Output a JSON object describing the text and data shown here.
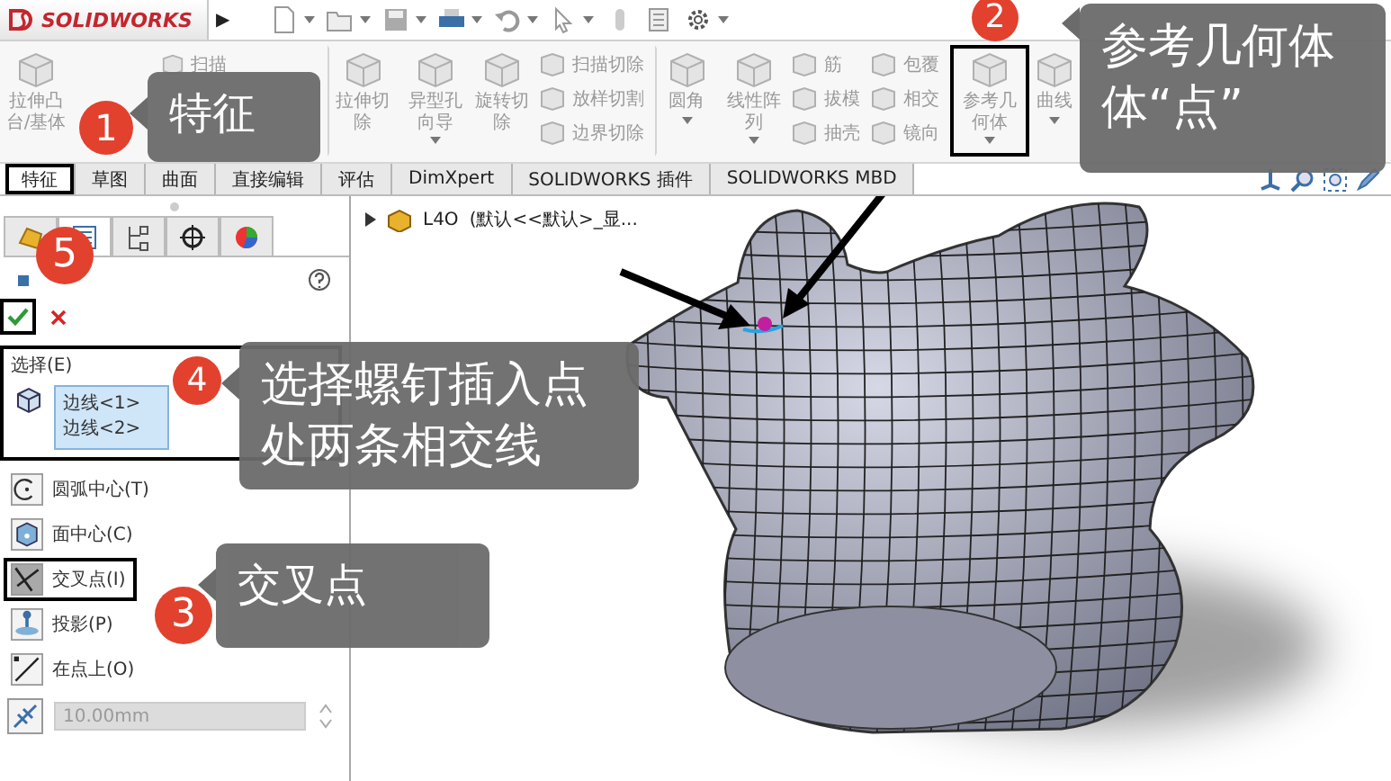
{
  "toolbar": {
    "logo": "SOLIDWORKS",
    "menu_arrow": "▶"
  },
  "ribbon": [
    {
      "kind": "large",
      "label": "拉伸凸台/基体",
      "highlighted": false,
      "dropdown": false
    },
    {
      "kind": "stack",
      "entries": [
        "扫描"
      ],
      "highlighted": false,
      "dropdown": false
    },
    {
      "kind": "large",
      "label": "拉伸切除",
      "highlighted": false,
      "dropdown": false
    },
    {
      "kind": "large",
      "label": "异型孔向导",
      "highlighted": false,
      "dropdown": true
    },
    {
      "kind": "large",
      "label": "旋转切除",
      "highlighted": false,
      "dropdown": false
    },
    {
      "kind": "stack",
      "entries": [
        "扫描切除",
        "放样切割",
        "边界切除"
      ],
      "highlighted": false,
      "dropdown": false
    },
    {
      "kind": "large",
      "label": "圆角",
      "highlighted": false,
      "dropdown": true
    },
    {
      "kind": "large",
      "label": "线性阵列",
      "highlighted": false,
      "dropdown": true
    },
    {
      "kind": "stack",
      "entries": [
        "筋",
        "拔模",
        "抽壳"
      ],
      "highlighted": false,
      "dropdown": false
    },
    {
      "kind": "stack",
      "entries": [
        "包覆",
        "相交",
        "镜向"
      ],
      "highlighted": false,
      "dropdown": false
    },
    {
      "kind": "large",
      "label": "参考几何体",
      "highlighted": true,
      "dropdown": true
    },
    {
      "kind": "large",
      "label": "曲线",
      "highlighted": false,
      "dropdown": true
    }
  ],
  "tabs": [
    {
      "label": "特征",
      "selected": true,
      "highlighted": true
    },
    {
      "label": "草图",
      "selected": false,
      "highlighted": false
    },
    {
      "label": "曲面",
      "selected": false,
      "highlighted": false
    },
    {
      "label": "直接编辑",
      "selected": false,
      "highlighted": false
    },
    {
      "label": "评估",
      "selected": false,
      "highlighted": false
    },
    {
      "label": "DimXpert",
      "selected": false,
      "highlighted": false
    },
    {
      "label": "SOLIDWORKS 插件",
      "selected": false,
      "highlighted": false
    },
    {
      "label": "SOLIDWORKS MBD",
      "selected": false,
      "highlighted": false
    }
  ],
  "panel": {
    "tabs": [
      {
        "kind": "feature",
        "selected": false
      },
      {
        "kind": "property",
        "selected": true
      },
      {
        "kind": "config",
        "selected": false
      },
      {
        "kind": "crosshair",
        "selected": false
      },
      {
        "kind": "appearance",
        "selected": false
      }
    ],
    "ok": {
      "highlighted": true
    },
    "selection": {
      "title": "选择(E)",
      "highlighted": true,
      "entries": [
        "边线<1>",
        "边线<2>"
      ]
    },
    "options": [
      {
        "kind": "arc-center",
        "label": "圆弧中心(T)",
        "selected": false,
        "highlighted": false
      },
      {
        "kind": "face-center",
        "label": "面中心(C)",
        "selected": false,
        "highlighted": false
      },
      {
        "kind": "intersection",
        "label": "交叉点(I)",
        "selected": true,
        "highlighted": true
      },
      {
        "kind": "projection",
        "label": "投影(P)",
        "selected": false,
        "highlighted": false
      },
      {
        "kind": "on-point",
        "label": "在点上(O)",
        "selected": false,
        "highlighted": false
      }
    ],
    "distance": {
      "value": "10.00mm",
      "disabled": true
    }
  },
  "viewport": {
    "tree": {
      "part": "L4O",
      "config": "(默认<<默认>_显..."
    }
  },
  "callouts": [
    {
      "number": "1",
      "text": "特征"
    },
    {
      "number": "2",
      "text": "参考几何体体“点”"
    },
    {
      "number": "5"
    },
    {
      "number": "4",
      "text": "选择螺钉插入点处两条相交线"
    },
    {
      "number": "3",
      "text": "交叉点"
    }
  ]
}
